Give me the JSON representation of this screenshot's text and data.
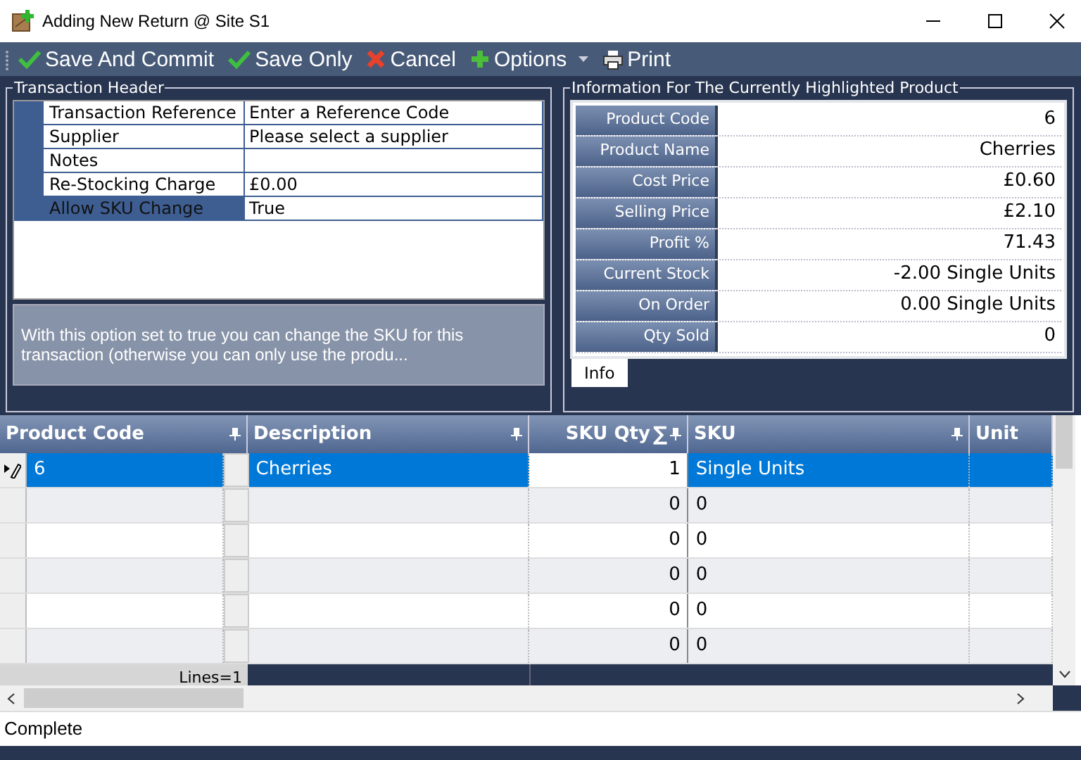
{
  "window": {
    "title": "Adding New Return @ Site S1"
  },
  "toolbar": [
    {
      "label": "Save And Commit",
      "kind": "check",
      "dropdown": false
    },
    {
      "label": "Save Only",
      "kind": "check",
      "dropdown": false
    },
    {
      "label": "Cancel",
      "kind": "cross",
      "dropdown": false
    },
    {
      "label": "Options",
      "kind": "plus",
      "dropdown": true
    },
    {
      "label": "Print",
      "kind": "printer",
      "dropdown": false
    }
  ],
  "transaction_header": {
    "title": "Transaction Header",
    "fields": [
      {
        "label": "Transaction Reference",
        "value": "Enter a Reference Code",
        "selected": false
      },
      {
        "label": "Supplier",
        "value": "Please select a supplier",
        "selected": false
      },
      {
        "label": "Notes",
        "selected": false
      },
      {
        "label": "Re-Stocking Charge",
        "value": "£0.00",
        "selected": false
      },
      {
        "label": "Allow SKU Change",
        "value": "True",
        "selected": true
      }
    ],
    "description": "With this option set to true you can change the SKU for this transaction (otherwise you can only use the produ..."
  },
  "product_info": {
    "title": "Information For The Currently Highlighted Product",
    "fields": [
      {
        "label": "Product Code",
        "value": "6"
      },
      {
        "label": "Product Name",
        "value": "Cherries"
      },
      {
        "label": "Cost Price",
        "value": "£0.60"
      },
      {
        "label": "Selling Price",
        "value": "£2.10"
      },
      {
        "label": "Profit %",
        "value": "71.43"
      },
      {
        "label": "Current Stock",
        "value": "-2.00 Single Units"
      },
      {
        "label": "On Order",
        "value": "0.00 Single Units"
      },
      {
        "label": "Qty Sold",
        "value": "0"
      }
    ],
    "tabs": [
      {
        "label": "Info",
        "selected": true
      }
    ]
  },
  "grid": {
    "columns": [
      {
        "label": "Product Code",
        "pin": true
      },
      {
        "label": "Description",
        "pin": true
      },
      {
        "label": "SKU Qty",
        "sum": "∑",
        "pin": true
      },
      {
        "label": "SKU",
        "pin": true
      },
      {
        "label": "Unit",
        "pin": false
      }
    ],
    "rows": [
      {
        "product_code": "6",
        "description": "Cherries",
        "sku_qty": "1",
        "sku": "Single Units",
        "selected": true,
        "editing": true
      },
      {
        "sku_qty": "0",
        "sku": "0",
        "selected": false,
        "editing": false
      },
      {
        "sku_qty": "0",
        "sku": "0",
        "selected": false,
        "editing": false
      },
      {
        "sku_qty": "0",
        "sku": "0",
        "selected": false,
        "editing": false
      },
      {
        "sku_qty": "0",
        "sku": "0",
        "selected": false,
        "editing": false
      },
      {
        "sku_qty": "0",
        "sku": "0",
        "selected": false,
        "editing": false
      }
    ],
    "footer": "Lines=1"
  },
  "status_bar": "Complete"
}
